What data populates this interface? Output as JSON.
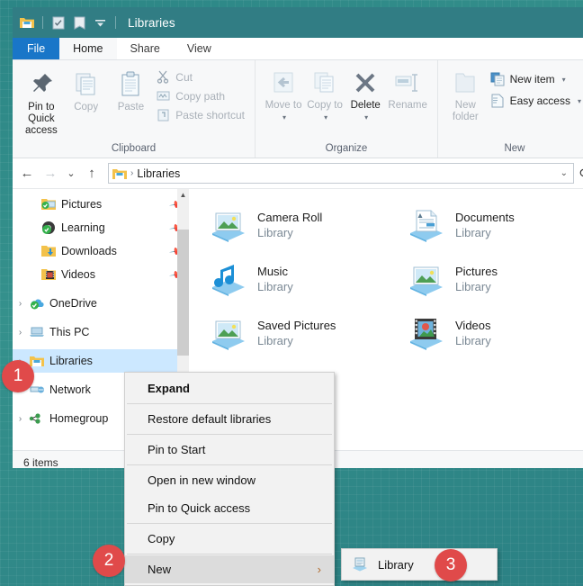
{
  "window": {
    "title": "Libraries",
    "titlebar_icons": [
      "folder-icon",
      "properties-icon",
      "new-folder-icon",
      "customize-quick-access-icon"
    ]
  },
  "ribbon": {
    "tabs": [
      {
        "label": "File",
        "state": "file"
      },
      {
        "label": "Home",
        "state": "active"
      },
      {
        "label": "Share",
        "state": "normal"
      },
      {
        "label": "View",
        "state": "normal"
      }
    ],
    "groups": [
      {
        "label": "Clipboard",
        "big_buttons": [
          {
            "label": "Pin to Quick access",
            "icon": "pin-icon",
            "enabled": true
          },
          {
            "label": "Copy",
            "icon": "copy-icon",
            "enabled": false
          },
          {
            "label": "Paste",
            "icon": "paste-icon",
            "enabled": false
          }
        ],
        "small_buttons": [
          {
            "label": "Cut",
            "icon": "scissors-icon",
            "enabled": false
          },
          {
            "label": "Copy path",
            "icon": "copy-path-icon",
            "enabled": false
          },
          {
            "label": "Paste shortcut",
            "icon": "paste-shortcut-icon",
            "enabled": false
          }
        ]
      },
      {
        "label": "Organize",
        "big_buttons": [
          {
            "label": "Move to",
            "icon": "move-to-icon",
            "enabled": false,
            "dropdown": true
          },
          {
            "label": "Copy to",
            "icon": "copy-to-icon",
            "enabled": false,
            "dropdown": true
          },
          {
            "label": "Delete",
            "icon": "delete-x-icon",
            "enabled": true,
            "dropdown": true
          },
          {
            "label": "Rename",
            "icon": "rename-icon",
            "enabled": false
          }
        ],
        "small_buttons": []
      },
      {
        "label": "New",
        "big_buttons": [
          {
            "label": "New folder",
            "icon": "new-folder-icon",
            "enabled": false
          }
        ],
        "small_buttons": [
          {
            "label": "New item",
            "icon": "new-item-icon",
            "enabled": true,
            "dropdown": true
          },
          {
            "label": "Easy access",
            "icon": "easy-access-icon",
            "enabled": true,
            "dropdown": true
          }
        ]
      }
    ]
  },
  "addressbar": {
    "back": "back-arrow-icon",
    "forward": "forward-arrow-icon",
    "recent": "recent-locations-icon",
    "up": "up-arrow-icon",
    "crumb_icon": "libraries-icon",
    "crumb_sep": "›",
    "path": "Libraries",
    "dropdown": "chevron-down-icon",
    "refresh": "refresh-icon"
  },
  "navpane": {
    "items": [
      {
        "label": "Pictures",
        "icon": "pictures-quick-icon",
        "chevron": false,
        "pinned": true,
        "indent": true,
        "selected": false
      },
      {
        "label": "Learning",
        "icon": "learning-icon",
        "chevron": false,
        "pinned": true,
        "indent": true,
        "selected": false
      },
      {
        "label": "Downloads",
        "icon": "downloads-icon",
        "chevron": false,
        "pinned": true,
        "indent": true,
        "selected": false
      },
      {
        "label": "Videos",
        "icon": "videos-icon",
        "chevron": false,
        "pinned": true,
        "indent": true,
        "selected": false
      },
      {
        "label": "OneDrive",
        "icon": "onedrive-icon",
        "chevron": true,
        "pinned": false,
        "indent": false,
        "selected": false
      },
      {
        "label": "This PC",
        "icon": "this-pc-icon",
        "chevron": true,
        "pinned": false,
        "indent": false,
        "selected": false
      },
      {
        "label": "Libraries",
        "icon": "libraries-icon",
        "chevron": true,
        "pinned": false,
        "indent": false,
        "selected": true
      },
      {
        "label": "Network",
        "icon": "network-icon",
        "chevron": true,
        "pinned": false,
        "indent": false,
        "selected": false
      },
      {
        "label": "Homegroup",
        "icon": "homegroup-icon",
        "chevron": true,
        "pinned": false,
        "indent": false,
        "selected": false
      }
    ],
    "scroll_up_arrow": "chevron-up-icon"
  },
  "content": {
    "items": [
      {
        "name": "Camera Roll",
        "sub": "Library",
        "icon": "picture-library-icon"
      },
      {
        "name": "Documents",
        "sub": "Library",
        "icon": "document-library-icon"
      },
      {
        "name": "Music",
        "sub": "Library",
        "icon": "music-library-icon"
      },
      {
        "name": "Pictures",
        "sub": "Library",
        "icon": "picture-library-icon"
      },
      {
        "name": "Saved Pictures",
        "sub": "Library",
        "icon": "picture-library-icon"
      },
      {
        "name": "Videos",
        "sub": "Library",
        "icon": "video-library-icon"
      }
    ]
  },
  "statusbar": {
    "text": "6 items"
  },
  "context_menu": {
    "items": [
      {
        "label": "Expand",
        "bold": true,
        "highlighted": false,
        "submenu": false,
        "sep_after": true
      },
      {
        "label": "Restore default libraries",
        "bold": false,
        "highlighted": false,
        "submenu": false,
        "sep_after": true
      },
      {
        "label": "Pin to Start",
        "bold": false,
        "highlighted": false,
        "submenu": false,
        "sep_after": true
      },
      {
        "label": "Open in new window",
        "bold": false,
        "highlighted": false,
        "submenu": false,
        "sep_after": false
      },
      {
        "label": "Pin to Quick access",
        "bold": false,
        "highlighted": false,
        "submenu": false,
        "sep_after": true
      },
      {
        "label": "Copy",
        "bold": false,
        "highlighted": false,
        "submenu": false,
        "sep_after": true
      },
      {
        "label": "New",
        "bold": false,
        "highlighted": true,
        "submenu": true,
        "sep_after": false
      }
    ],
    "submenu_arrow": "›"
  },
  "submenu": {
    "items": [
      {
        "label": "Library",
        "icon": "new-library-icon"
      }
    ]
  },
  "badges": [
    {
      "number": "1"
    },
    {
      "number": "2"
    },
    {
      "number": "3"
    }
  ],
  "colors": {
    "titlebar": "#317d84",
    "file_tab": "#1976c8",
    "selection": "#cce8ff",
    "badge": "#e04a4a",
    "desktop": "#2f8a8a"
  }
}
